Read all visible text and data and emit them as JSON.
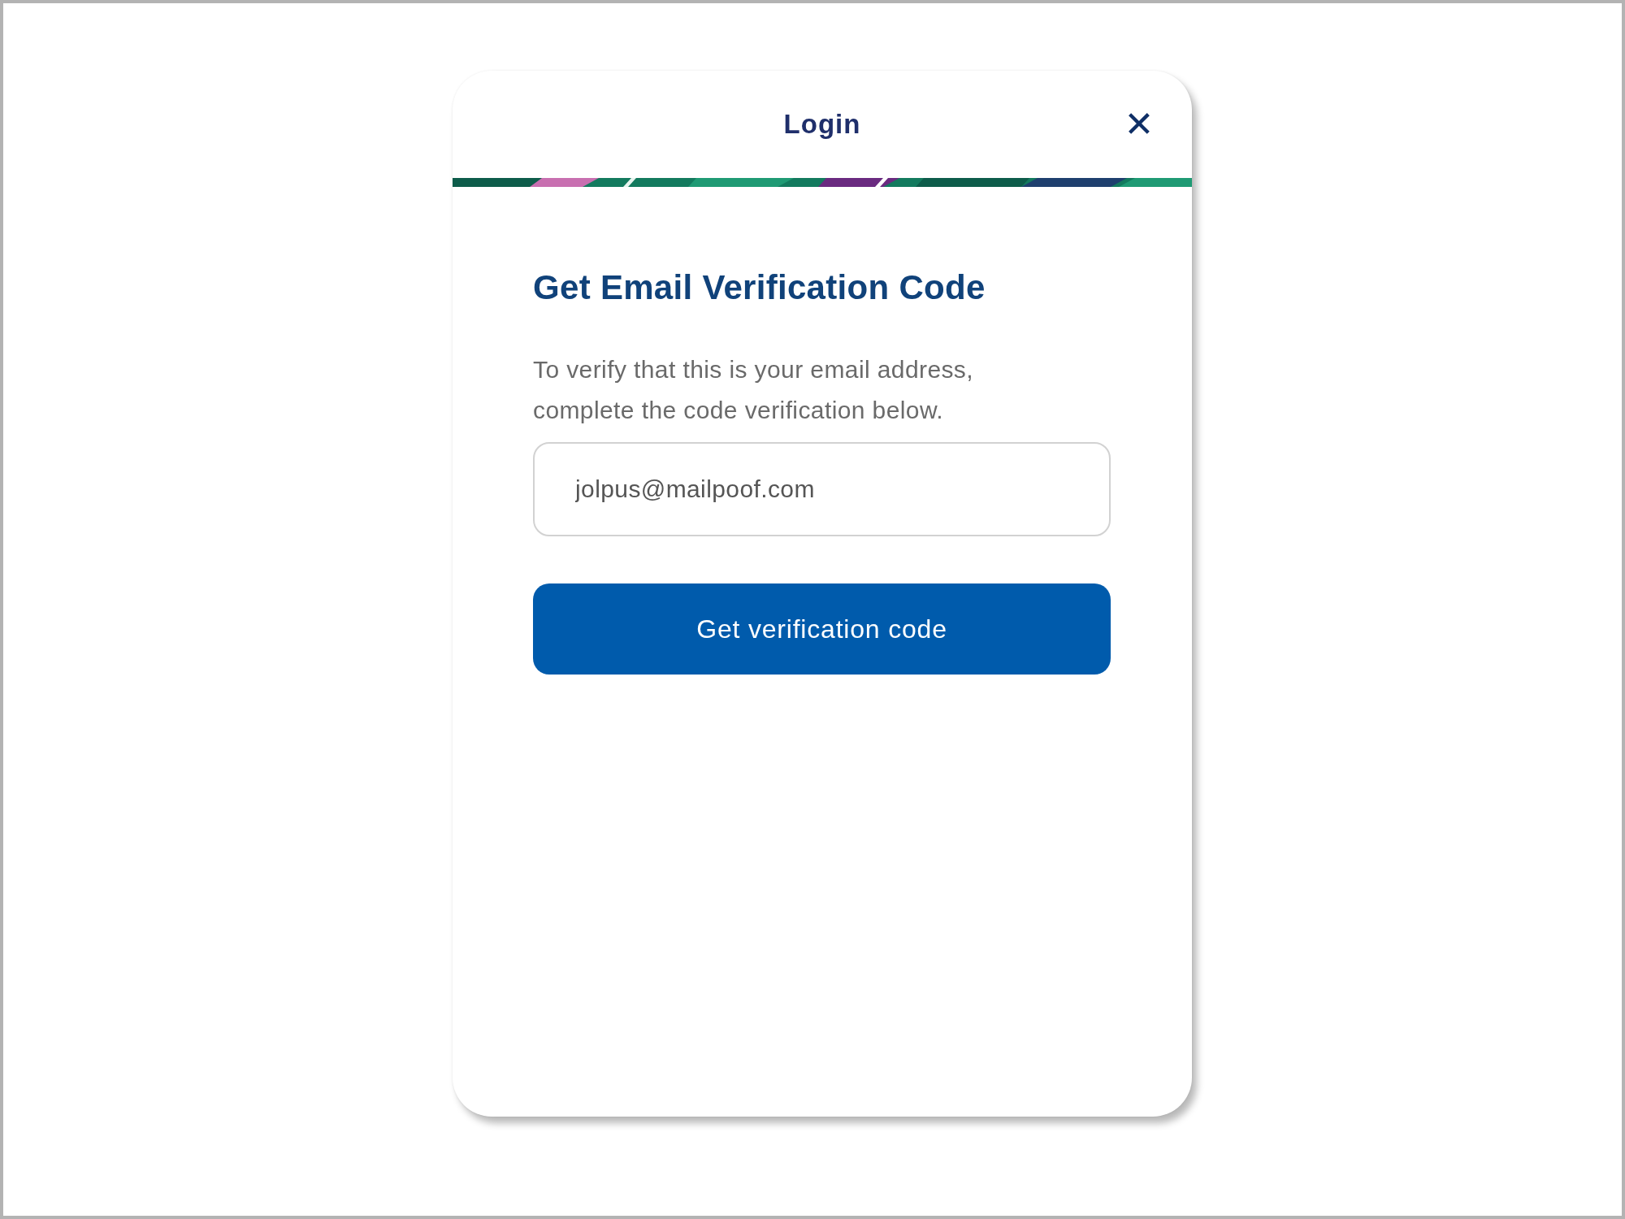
{
  "dialog": {
    "title": "Login",
    "close_label": "✕"
  },
  "heading": "Get Email Verification Code",
  "description": "To verify that this is your email address, complete the code verification below.",
  "email_field": {
    "value": "jolpus@mailpoof.com"
  },
  "submit_button": {
    "label": "Get verification code"
  }
}
